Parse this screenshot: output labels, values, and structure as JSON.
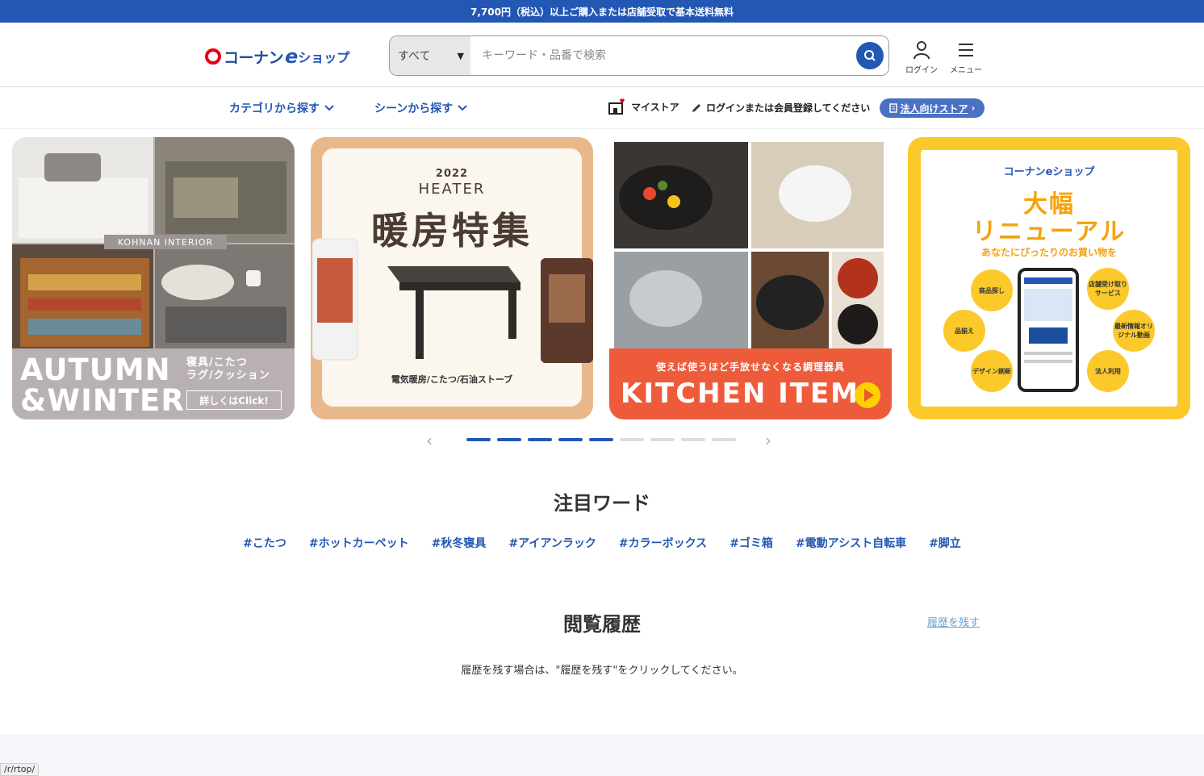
{
  "topbar": {
    "text": "7,700円（税込）以上ご購入または店舗受取で基本送料無料"
  },
  "logo": {
    "text": "コーナン",
    "e": "e",
    "shop": "ショップ"
  },
  "search": {
    "category": "すべて",
    "placeholder": "キーワード・品番で検索"
  },
  "header": {
    "login": "ログイン",
    "menu": "メニュー"
  },
  "subnav": {
    "category": "カテゴリから探す",
    "scene": "シーンから探す",
    "mystore": "マイストア",
    "login_msg": "ログインまたは会員登録してください",
    "corporate": "法人向けストア"
  },
  "banners": {
    "b1": {
      "tag": "KOHNAN INTERIOR",
      "title1": "AUTUMN",
      "title2": "&WINTER",
      "sub1": "寝具/こたつ",
      "sub2": "ラグ/クッション",
      "click": "詳しくはClick!"
    },
    "b2": {
      "year": "2022",
      "heater": "HEATER",
      "title": "暖房特集",
      "caption": "電気暖房/こたつ/石油ストーブ"
    },
    "b3": {
      "band": "使えば使うほど手放せなくなる調理器具",
      "title": "KITCHEN ITEM"
    },
    "b4": {
      "logo": "コーナンeショップ",
      "line1": "大幅",
      "line2": "リニューアル",
      "sub": "あなたにぴったりのお買い物を",
      "bubbles": [
        "商品探し",
        "品揃え",
        "デザイン刷新",
        "店舗受け取りサービス",
        "最新情報オリジナル動画",
        "法人利用"
      ]
    }
  },
  "carousel": {
    "prev": "‹",
    "next": "›",
    "total": 9,
    "active": 5
  },
  "attention": {
    "title": "注目ワード",
    "tags": [
      "#こたつ",
      "#ホットカーペット",
      "#秋冬寝具",
      "#アイアンラック",
      "#カラーボックス",
      "#ゴミ箱",
      "#電動アシスト自転車",
      "#脚立"
    ]
  },
  "history": {
    "title": "閲覧履歴",
    "link": "履歴を残す",
    "message": "履歴を残す場合は、\"履歴を残す\"をクリックしてください。"
  },
  "status_url": "/r/rtop/",
  "colors": {
    "brand": "#2357b4",
    "accent": "#e60012",
    "kitchen": "#ee5b3a",
    "renewal": "#fcc92b"
  }
}
